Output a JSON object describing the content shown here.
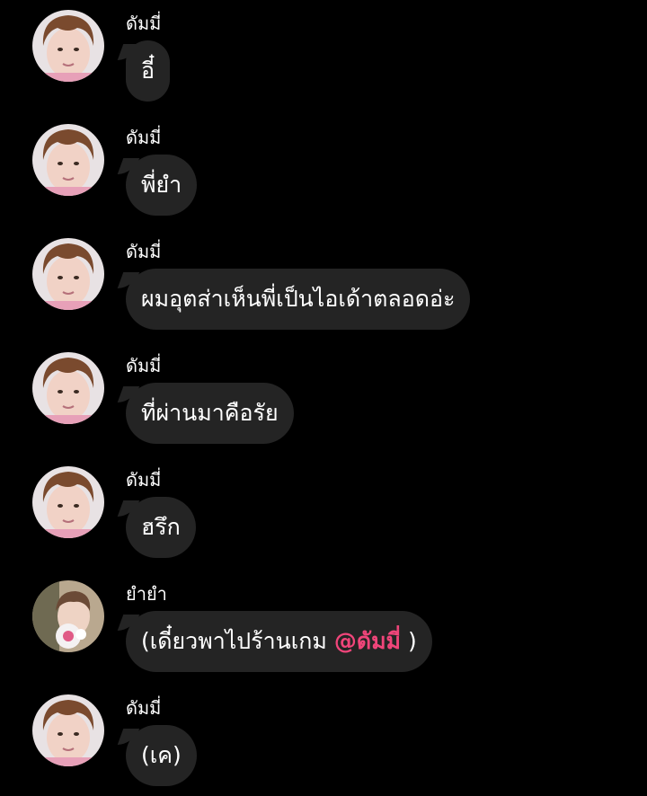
{
  "messages": [
    {
      "sender": "ดัมมี่",
      "avatar": "dummy-avatar",
      "text": "อี๋"
    },
    {
      "sender": "ดัมมี่",
      "avatar": "dummy-avatar",
      "text": "พี่ยำ"
    },
    {
      "sender": "ดัมมี่",
      "avatar": "dummy-avatar",
      "text": "ผมอุตส่าเห็นพี่เป็นไอเด้าตลอดอ่ะ"
    },
    {
      "sender": "ดัมมี่",
      "avatar": "dummy-avatar",
      "text": "ที่ผ่านมาคือรัย"
    },
    {
      "sender": "ดัมมี่",
      "avatar": "dummy-avatar",
      "text": "ฮรึก"
    },
    {
      "sender": "ยำยำ",
      "avatar": "yamyam-avatar",
      "text_before": "(เดี๋ยวพาไปร้านเกม ",
      "mention": "@ดัมมี่",
      "text_after": " )"
    },
    {
      "sender": "ดัมมี่",
      "avatar": "dummy-avatar",
      "text": "(เค)"
    }
  ],
  "colors": {
    "background": "#000000",
    "bubble": "#242424",
    "text": "#ffffff",
    "mention": "#f0457a"
  }
}
